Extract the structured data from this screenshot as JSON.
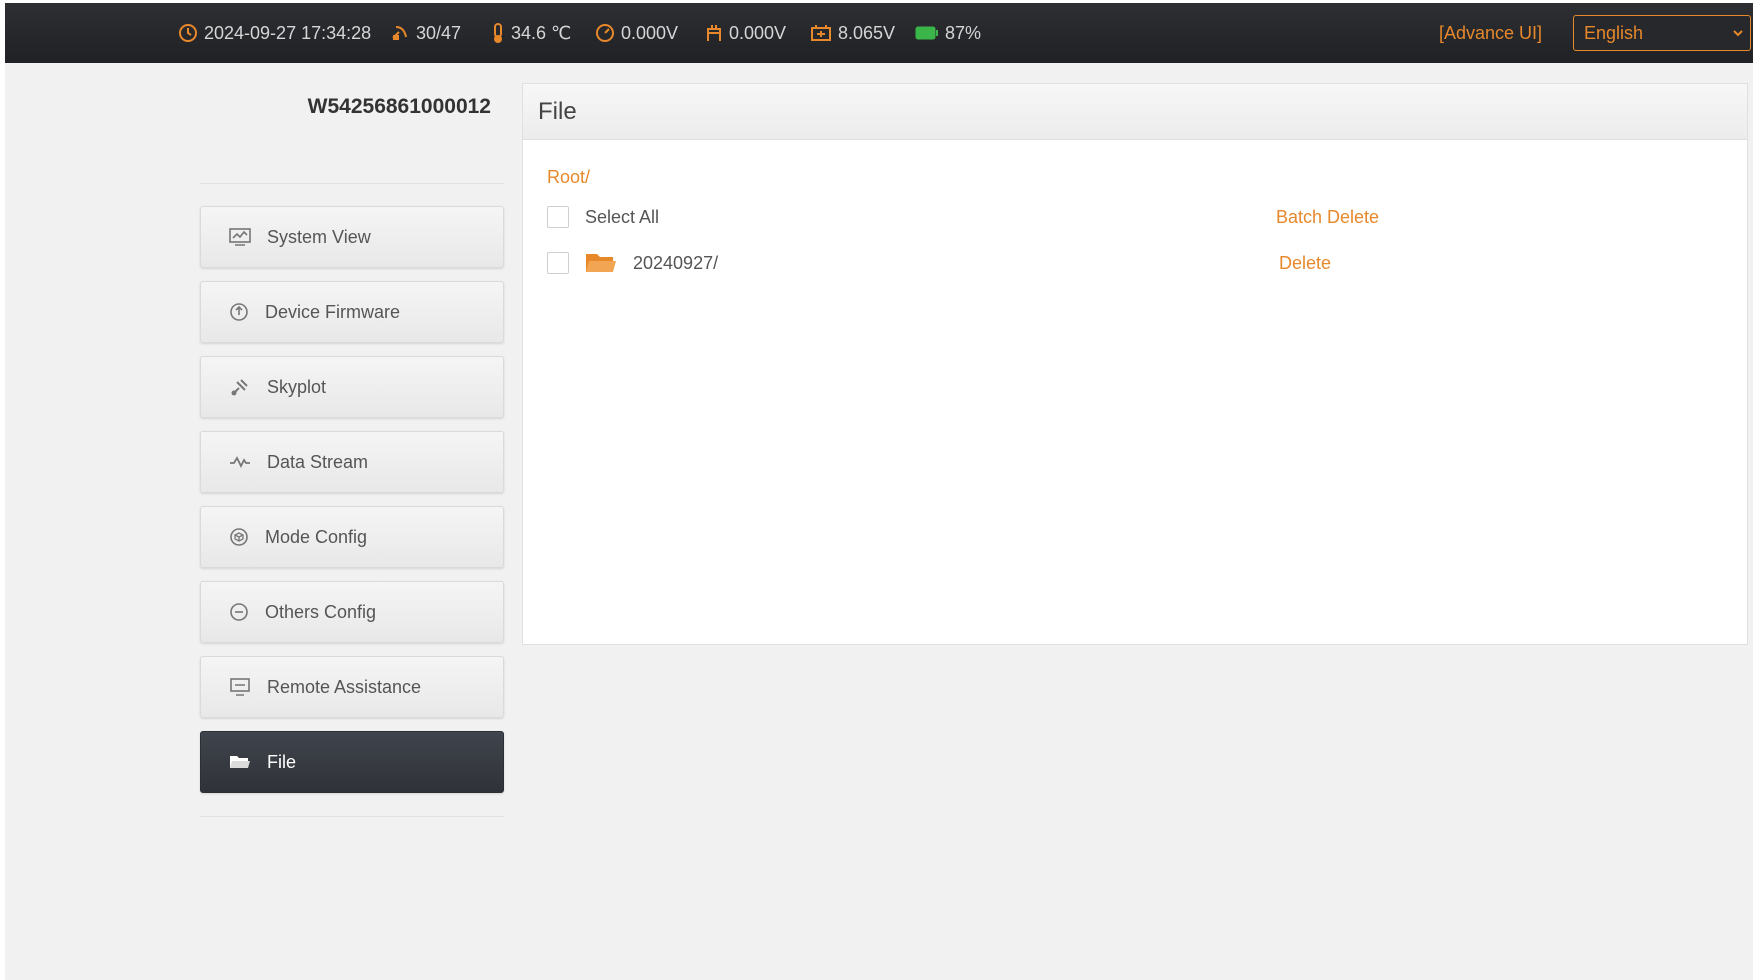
{
  "status_bar": {
    "datetime": "2024-09-27 17:34:28",
    "satellites": "30/47",
    "temperature": "34.6 ℃",
    "voltage_1": "0.000V",
    "voltage_2": "0.000V",
    "voltage_3": "8.065V",
    "battery": "87%",
    "advance_link": "[Advance UI]",
    "language": "English",
    "accent_color": "#e7882b"
  },
  "sidebar": {
    "device_id": "W54256861000012",
    "items": [
      {
        "label": "System View",
        "icon": "monitor-icon"
      },
      {
        "label": "Device Firmware",
        "icon": "firmware-icon"
      },
      {
        "label": "Skyplot",
        "icon": "satellite-icon"
      },
      {
        "label": "Data Stream",
        "icon": "pulse-icon"
      },
      {
        "label": "Mode Config",
        "icon": "cube-icon"
      },
      {
        "label": "Others Config",
        "icon": "more-icon"
      },
      {
        "label": "Remote Assistance",
        "icon": "remote-icon"
      },
      {
        "label": "File",
        "icon": "folder-icon",
        "active": true
      }
    ]
  },
  "file_panel": {
    "title": "File",
    "breadcrumb": "Root/",
    "select_all_label": "Select All",
    "batch_delete_label": "Batch Delete",
    "entries": [
      {
        "name": "20240927/",
        "action": "Delete",
        "type": "folder"
      }
    ]
  }
}
